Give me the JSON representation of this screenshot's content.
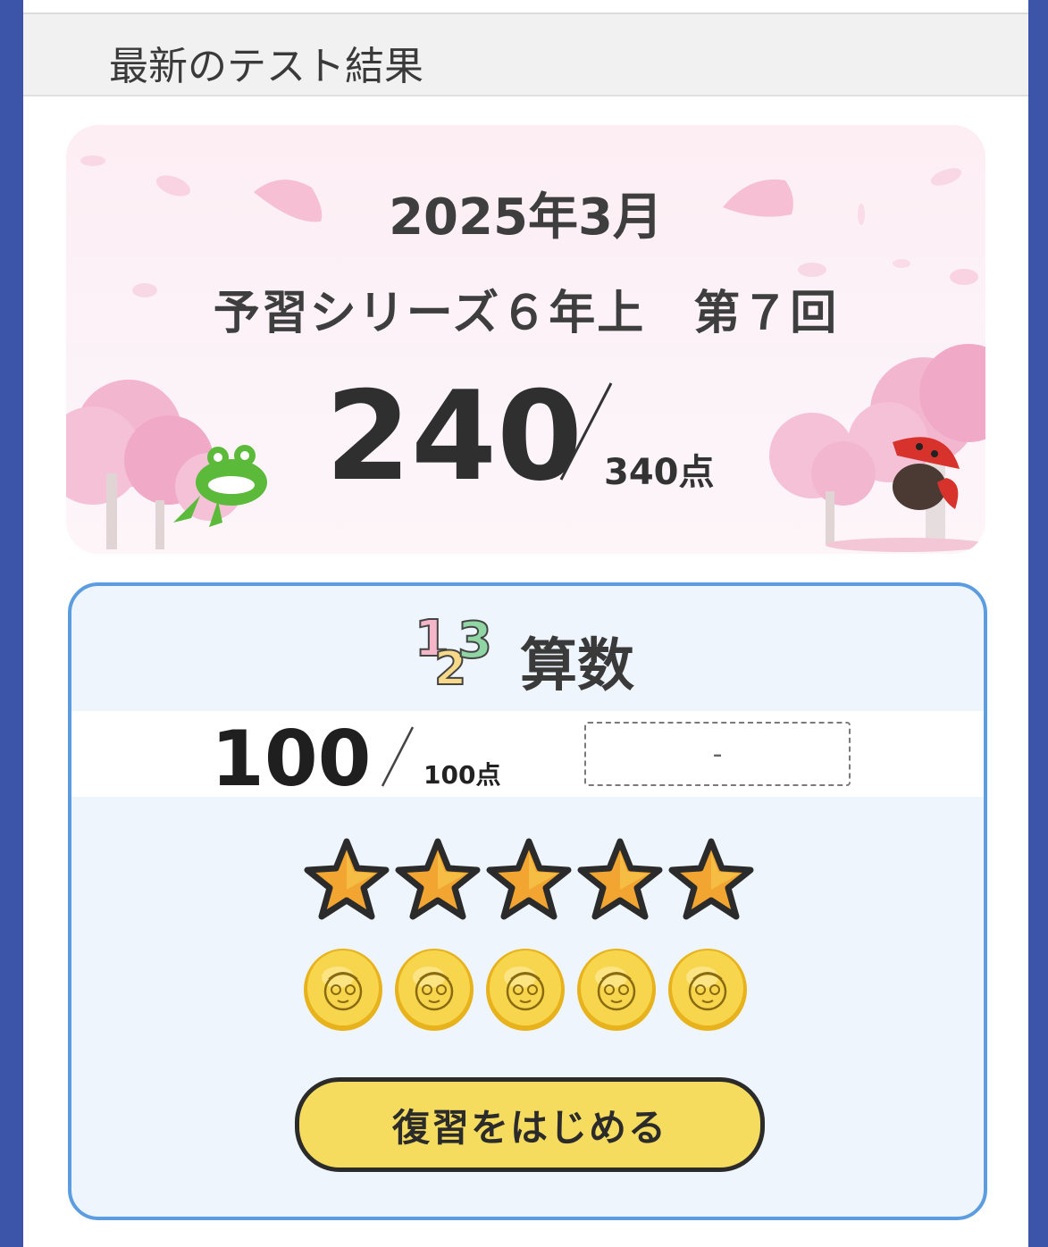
{
  "section": {
    "title": "最新のテスト結果"
  },
  "hero": {
    "date": "2025年3月",
    "series": "予習シリーズ６年上　第７回",
    "score": "240",
    "total": "340点"
  },
  "subject": {
    "name": "算数",
    "icon_text": "123",
    "score": "100",
    "total": "100点",
    "rank": "-",
    "stars": 5,
    "coins": 5,
    "review_button": "復習をはじめる"
  },
  "colors": {
    "frame": "#3d55a8",
    "card_border": "#5b9de0",
    "button": "#f6dc5e",
    "star": "#f2a531"
  }
}
